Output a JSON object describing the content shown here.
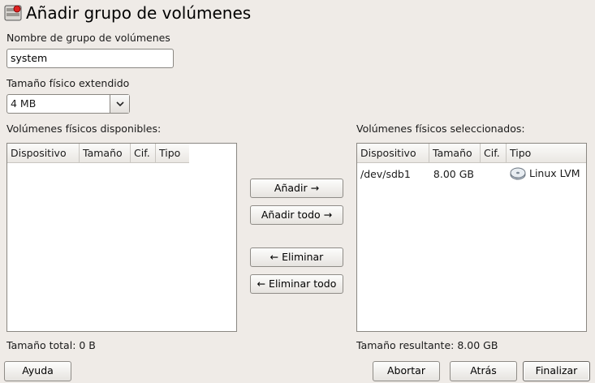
{
  "dialog": {
    "title": "Añadir grupo de volúmenes"
  },
  "group_name": {
    "label": "Nombre de grupo de volúmenes",
    "value": "system"
  },
  "extent_size": {
    "label": "Tamaño físico extendido",
    "value": "4 MB"
  },
  "available": {
    "label": "Volúmenes físicos disponibles:",
    "columns": [
      "Dispositivo",
      "Tamaño",
      "Cif.",
      "Tipo"
    ],
    "rows": [],
    "total": "Tamaño total: 0 B"
  },
  "selected": {
    "label": "Volúmenes físicos seleccionados:",
    "columns": [
      "Dispositivo",
      "Tamaño",
      "Cif.",
      "Tipo"
    ],
    "rows": [
      {
        "device": "/dev/sdb1",
        "size": "8.00 GB",
        "encrypted": "",
        "type": "Linux LVM",
        "icon": "disk-icon"
      }
    ],
    "total": "Tamaño resultante: 8.00 GB"
  },
  "transfer_buttons": {
    "add": "Añadir →",
    "add_all": "Añadir todo →",
    "remove": "← Eliminar",
    "remove_all": "← Eliminar todo"
  },
  "footer": {
    "help": "Ayuda",
    "abort": "Abortar",
    "back": "Atrás",
    "finish": "Finalizar"
  },
  "colors": {
    "background": "#efebe7",
    "title_icon_accent": "#d22"
  }
}
